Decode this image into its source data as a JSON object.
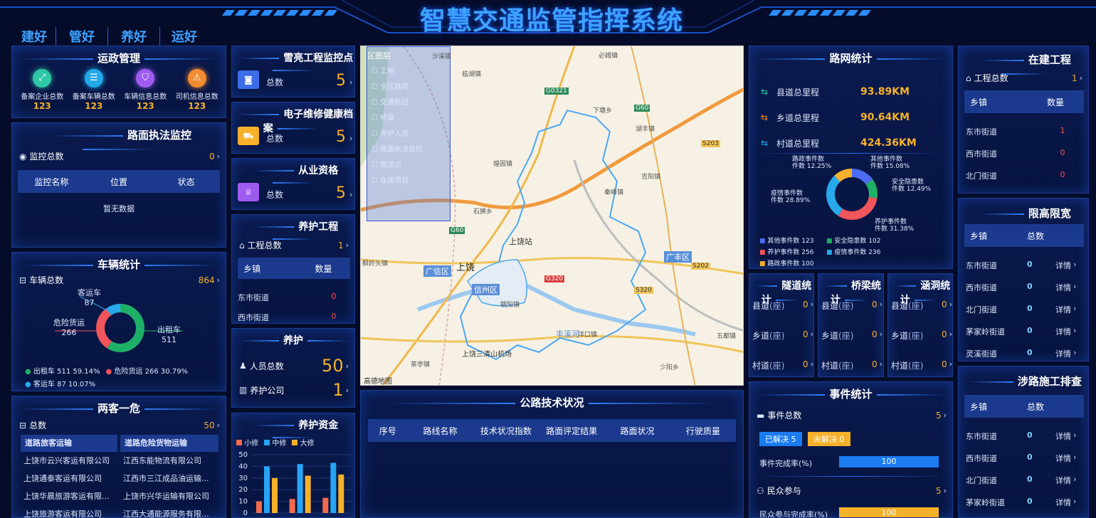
{
  "header": {
    "title": "智慧交通监管指挥系统",
    "tabs": [
      "建好",
      "管好",
      "养好",
      "运好"
    ]
  },
  "yunzheng": {
    "title": "运政管理",
    "items": [
      {
        "label": "备案企业总数",
        "value": "123",
        "color": "#2fc7a5"
      },
      {
        "label": "备案车辆总数",
        "value": "123",
        "color": "#23a8e8"
      },
      {
        "label": "车辆信息总数",
        "value": "123",
        "color": "#9e5bef"
      },
      {
        "label": "司机信息总数",
        "value": "123",
        "color": "#f38b31"
      }
    ]
  },
  "lumian": {
    "title": "路面执法监控",
    "count_label": "监控总数",
    "count": "0",
    "cols": [
      "监控名称",
      "位置",
      "状态"
    ],
    "empty": "暂无数据"
  },
  "vehicle": {
    "title": "车辆统计",
    "total_label": "车辆总数",
    "total": "864",
    "labels": [
      {
        "name": "客运车",
        "value": "87"
      },
      {
        "name": "危险货运",
        "value": "266"
      },
      {
        "name": "出租车",
        "value": "511"
      }
    ],
    "legend": [
      {
        "name": "出租车",
        "value": "511",
        "pct": "59.14%",
        "color": "#1fb067"
      },
      {
        "name": "危险货运",
        "value": "266",
        "pct": "30.79%",
        "color": "#f0555b"
      },
      {
        "name": "客运车",
        "value": "87",
        "pct": "10.07%",
        "color": "#28a9ec"
      }
    ]
  },
  "liangke": {
    "title": "两客一危",
    "total_label": "总数",
    "total": "50",
    "cols": [
      "道路旅客运输",
      "道路危险货物运输"
    ],
    "rows": [
      [
        "上饶市云兴客运有限公司",
        "江西东能物流有限公司"
      ],
      [
        "上饶通泰客运有限公司",
        "江西市三江成品油运输..."
      ],
      [
        "上饶华晨旅游客运有限...",
        "上饶市兴华运输有限公司"
      ],
      [
        "上饶旅游客运有限公司",
        "江西大通能源服务有限..."
      ]
    ]
  },
  "col2": {
    "xueliang": {
      "title": "雪亮工程监控点",
      "label": "总数",
      "value": "5"
    },
    "weixiu": {
      "title": "电子维修健康档案",
      "label": "总数",
      "value": "5"
    },
    "congye": {
      "title": "从业资格",
      "label": "总数",
      "value": "5"
    }
  },
  "yanghu_project": {
    "title": "养护工程",
    "total_label": "工程总数",
    "total": "1",
    "cols": [
      "乡镇",
      "数量"
    ],
    "rows": [
      [
        "东市街道",
        "0"
      ],
      [
        "西市街道",
        "0"
      ]
    ]
  },
  "yanghu": {
    "title": "养护",
    "people_label": "人员总数",
    "people": "50",
    "company_label": "养护公司",
    "company": "1"
  },
  "funds": {
    "title": "养护资金",
    "legend": [
      {
        "name": "小修",
        "color": "#f46b4b"
      },
      {
        "name": "中修",
        "color": "#27a4f5"
      },
      {
        "name": "大修",
        "color": "#f5b12a"
      }
    ],
    "yticks": [
      "50",
      "40",
      "30",
      "20",
      "10",
      "0"
    ]
  },
  "chart_data": {
    "type": "bar",
    "series": [
      {
        "name": "小修",
        "values": [
          10,
          12,
          13
        ]
      },
      {
        "name": "中修",
        "values": [
          40,
          42,
          43
        ]
      },
      {
        "name": "大修",
        "values": [
          30,
          32,
          33
        ]
      }
    ],
    "categories": [
      "",
      "",
      ""
    ],
    "ylim": [
      0,
      50
    ]
  },
  "map": {
    "layer_title": "区图层",
    "layers": [
      "工地",
      "全区路网",
      "交通枢纽",
      "桥梁",
      "养护人员",
      "路面执法监控",
      "物流点",
      "在建项目"
    ],
    "places": [
      "上饶站",
      "上饶",
      "信州区",
      "广信区",
      "广丰区",
      "上饶三清山机场",
      "丰溪河",
      "沙溪镇",
      "下塘乡",
      "石狮乡",
      "茶亭镇",
      "洋口镇",
      "五都镇",
      "少阳乡",
      "临湖镇",
      "必姆镇",
      "枫岭头镇",
      "煌固镇",
      "秦峰镇",
      "吉阳镇",
      "湖丰镇",
      "朝阳镇"
    ],
    "roads": [
      "G0321",
      "G60",
      "S203",
      "S202",
      "G320",
      "S320",
      "G60"
    ],
    "copyright": "高德地图"
  },
  "gonglu": {
    "title": "公路技术状况",
    "cols": [
      "序号",
      "路线名称",
      "技术状况指数",
      "路面评定结果",
      "路面状况",
      "行驶质量"
    ]
  },
  "luwang": {
    "title": "路网统计",
    "items": [
      {
        "label": "县道总里程",
        "value": "93.89KM"
      },
      {
        "label": "乡道总里程",
        "value": "90.64KM"
      },
      {
        "label": "村道总里程",
        "value": "424.36KM"
      }
    ],
    "donut": [
      {
        "name": "其他事件数",
        "value": "123",
        "pct": "15.08%",
        "color": "#4b6cf2"
      },
      {
        "name": "安全隐患数",
        "value": "102",
        "pct": "12.49%",
        "color": "#1fb067"
      },
      {
        "name": "养护事件数",
        "value": "256",
        "pct": "31.38%",
        "color": "#f0555b"
      },
      {
        "name": "疫情事件数",
        "value": "236",
        "pct": "28.89%",
        "color": "#28a9ec"
      },
      {
        "name": "路政事件数",
        "value": "100",
        "pct": "12.25%",
        "color": "#f5b12a"
      }
    ],
    "unit": "件数"
  },
  "tunnel": {
    "title": "隧道统计",
    "rows": [
      {
        "label": "县道",
        "unit": "(座)",
        "value": "0"
      },
      {
        "label": "乡道",
        "unit": "(座)",
        "value": "0"
      },
      {
        "label": "村道",
        "unit": "(座)",
        "value": "0"
      }
    ]
  },
  "bridge": {
    "title": "桥梁统计",
    "rows": [
      {
        "label": "县道",
        "unit": "(座)",
        "value": "0"
      },
      {
        "label": "乡道",
        "unit": "(座)",
        "value": "0"
      },
      {
        "label": "村道",
        "unit": "(座)",
        "value": "0"
      }
    ]
  },
  "culvert": {
    "title": "涵洞统计",
    "rows": [
      {
        "label": "县道",
        "unit": "(座)",
        "value": "0"
      },
      {
        "label": "乡道",
        "unit": "(座)",
        "value": "0"
      },
      {
        "label": "村道",
        "unit": "(座)",
        "value": "0"
      }
    ]
  },
  "events": {
    "title": "事件统计",
    "total_label": "事件总数",
    "total": "5",
    "solved": "已解决 5",
    "unsolved": "未解决 0",
    "rate_label": "事件完成率(%)",
    "rate": "100",
    "public_label": "民众参与",
    "public": "5",
    "public_rate_label": "民众参与完成率(%)",
    "public_rate": "100"
  },
  "zaijian": {
    "title": "在建工程",
    "total_label": "工程总数",
    "total": "1",
    "cols": [
      "乡镇",
      "数量"
    ],
    "rows": [
      [
        "东市街道",
        "1"
      ],
      [
        "西市街道",
        "0"
      ],
      [
        "北门街道",
        "0"
      ]
    ]
  },
  "xiangao": {
    "title": "限高限宽",
    "cols": [
      "乡镇",
      "总数"
    ],
    "rows": [
      [
        "东市街道",
        "0"
      ],
      [
        "西市街道",
        "0"
      ],
      [
        "北门街道",
        "0"
      ],
      [
        "茅家岭街道",
        "0"
      ],
      [
        "灵溪街道",
        "0"
      ]
    ],
    "detail": "详情"
  },
  "shelu": {
    "title": "涉路施工排查",
    "cols": [
      "乡镇",
      "总数"
    ],
    "rows": [
      [
        "东市街道",
        "0"
      ],
      [
        "西市街道",
        "0"
      ],
      [
        "北门街道",
        "0"
      ],
      [
        "茅家岭街道",
        "0"
      ]
    ],
    "detail": "详情"
  }
}
